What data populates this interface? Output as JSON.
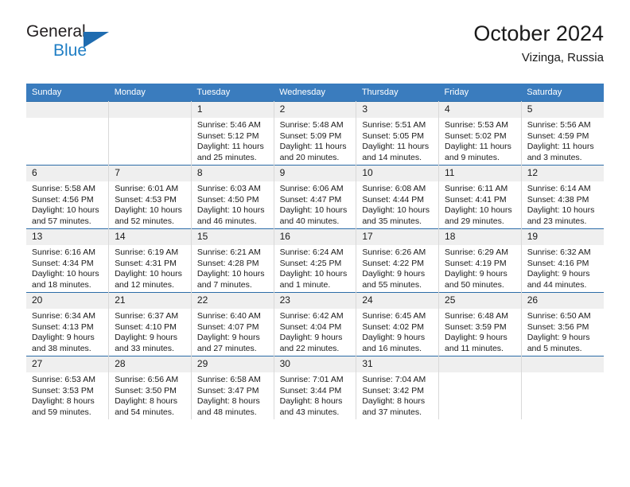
{
  "brand": {
    "name_top": "General",
    "name_bottom": "Blue",
    "accent_color": "#1f7ec4",
    "triangle_color": "#1f6cb0"
  },
  "header": {
    "title": "October 2024",
    "subtitle": "Vizinga, Russia",
    "header_bg": "#3a7cbe",
    "header_text_color": "#ffffff",
    "daynum_bg": "#efefef",
    "row_border_color": "#2c6ca8"
  },
  "weekdays": [
    "Sunday",
    "Monday",
    "Tuesday",
    "Wednesday",
    "Thursday",
    "Friday",
    "Saturday"
  ],
  "weeks": [
    [
      {
        "day": "",
        "empty": true
      },
      {
        "day": "",
        "empty": true
      },
      {
        "day": "1",
        "sunrise": "Sunrise: 5:46 AM",
        "sunset": "Sunset: 5:12 PM",
        "daylight": "Daylight: 11 hours and 25 minutes."
      },
      {
        "day": "2",
        "sunrise": "Sunrise: 5:48 AM",
        "sunset": "Sunset: 5:09 PM",
        "daylight": "Daylight: 11 hours and 20 minutes."
      },
      {
        "day": "3",
        "sunrise": "Sunrise: 5:51 AM",
        "sunset": "Sunset: 5:05 PM",
        "daylight": "Daylight: 11 hours and 14 minutes."
      },
      {
        "day": "4",
        "sunrise": "Sunrise: 5:53 AM",
        "sunset": "Sunset: 5:02 PM",
        "daylight": "Daylight: 11 hours and 9 minutes."
      },
      {
        "day": "5",
        "sunrise": "Sunrise: 5:56 AM",
        "sunset": "Sunset: 4:59 PM",
        "daylight": "Daylight: 11 hours and 3 minutes."
      }
    ],
    [
      {
        "day": "6",
        "sunrise": "Sunrise: 5:58 AM",
        "sunset": "Sunset: 4:56 PM",
        "daylight": "Daylight: 10 hours and 57 minutes."
      },
      {
        "day": "7",
        "sunrise": "Sunrise: 6:01 AM",
        "sunset": "Sunset: 4:53 PM",
        "daylight": "Daylight: 10 hours and 52 minutes."
      },
      {
        "day": "8",
        "sunrise": "Sunrise: 6:03 AM",
        "sunset": "Sunset: 4:50 PM",
        "daylight": "Daylight: 10 hours and 46 minutes."
      },
      {
        "day": "9",
        "sunrise": "Sunrise: 6:06 AM",
        "sunset": "Sunset: 4:47 PM",
        "daylight": "Daylight: 10 hours and 40 minutes."
      },
      {
        "day": "10",
        "sunrise": "Sunrise: 6:08 AM",
        "sunset": "Sunset: 4:44 PM",
        "daylight": "Daylight: 10 hours and 35 minutes."
      },
      {
        "day": "11",
        "sunrise": "Sunrise: 6:11 AM",
        "sunset": "Sunset: 4:41 PM",
        "daylight": "Daylight: 10 hours and 29 minutes."
      },
      {
        "day": "12",
        "sunrise": "Sunrise: 6:14 AM",
        "sunset": "Sunset: 4:38 PM",
        "daylight": "Daylight: 10 hours and 23 minutes."
      }
    ],
    [
      {
        "day": "13",
        "sunrise": "Sunrise: 6:16 AM",
        "sunset": "Sunset: 4:34 PM",
        "daylight": "Daylight: 10 hours and 18 minutes."
      },
      {
        "day": "14",
        "sunrise": "Sunrise: 6:19 AM",
        "sunset": "Sunset: 4:31 PM",
        "daylight": "Daylight: 10 hours and 12 minutes."
      },
      {
        "day": "15",
        "sunrise": "Sunrise: 6:21 AM",
        "sunset": "Sunset: 4:28 PM",
        "daylight": "Daylight: 10 hours and 7 minutes."
      },
      {
        "day": "16",
        "sunrise": "Sunrise: 6:24 AM",
        "sunset": "Sunset: 4:25 PM",
        "daylight": "Daylight: 10 hours and 1 minute."
      },
      {
        "day": "17",
        "sunrise": "Sunrise: 6:26 AM",
        "sunset": "Sunset: 4:22 PM",
        "daylight": "Daylight: 9 hours and 55 minutes."
      },
      {
        "day": "18",
        "sunrise": "Sunrise: 6:29 AM",
        "sunset": "Sunset: 4:19 PM",
        "daylight": "Daylight: 9 hours and 50 minutes."
      },
      {
        "day": "19",
        "sunrise": "Sunrise: 6:32 AM",
        "sunset": "Sunset: 4:16 PM",
        "daylight": "Daylight: 9 hours and 44 minutes."
      }
    ],
    [
      {
        "day": "20",
        "sunrise": "Sunrise: 6:34 AM",
        "sunset": "Sunset: 4:13 PM",
        "daylight": "Daylight: 9 hours and 38 minutes."
      },
      {
        "day": "21",
        "sunrise": "Sunrise: 6:37 AM",
        "sunset": "Sunset: 4:10 PM",
        "daylight": "Daylight: 9 hours and 33 minutes."
      },
      {
        "day": "22",
        "sunrise": "Sunrise: 6:40 AM",
        "sunset": "Sunset: 4:07 PM",
        "daylight": "Daylight: 9 hours and 27 minutes."
      },
      {
        "day": "23",
        "sunrise": "Sunrise: 6:42 AM",
        "sunset": "Sunset: 4:04 PM",
        "daylight": "Daylight: 9 hours and 22 minutes."
      },
      {
        "day": "24",
        "sunrise": "Sunrise: 6:45 AM",
        "sunset": "Sunset: 4:02 PM",
        "daylight": "Daylight: 9 hours and 16 minutes."
      },
      {
        "day": "25",
        "sunrise": "Sunrise: 6:48 AM",
        "sunset": "Sunset: 3:59 PM",
        "daylight": "Daylight: 9 hours and 11 minutes."
      },
      {
        "day": "26",
        "sunrise": "Sunrise: 6:50 AM",
        "sunset": "Sunset: 3:56 PM",
        "daylight": "Daylight: 9 hours and 5 minutes."
      }
    ],
    [
      {
        "day": "27",
        "sunrise": "Sunrise: 6:53 AM",
        "sunset": "Sunset: 3:53 PM",
        "daylight": "Daylight: 8 hours and 59 minutes."
      },
      {
        "day": "28",
        "sunrise": "Sunrise: 6:56 AM",
        "sunset": "Sunset: 3:50 PM",
        "daylight": "Daylight: 8 hours and 54 minutes."
      },
      {
        "day": "29",
        "sunrise": "Sunrise: 6:58 AM",
        "sunset": "Sunset: 3:47 PM",
        "daylight": "Daylight: 8 hours and 48 minutes."
      },
      {
        "day": "30",
        "sunrise": "Sunrise: 7:01 AM",
        "sunset": "Sunset: 3:44 PM",
        "daylight": "Daylight: 8 hours and 43 minutes."
      },
      {
        "day": "31",
        "sunrise": "Sunrise: 7:04 AM",
        "sunset": "Sunset: 3:42 PM",
        "daylight": "Daylight: 8 hours and 37 minutes."
      },
      {
        "day": "",
        "empty": true
      },
      {
        "day": "",
        "empty": true
      }
    ]
  ]
}
